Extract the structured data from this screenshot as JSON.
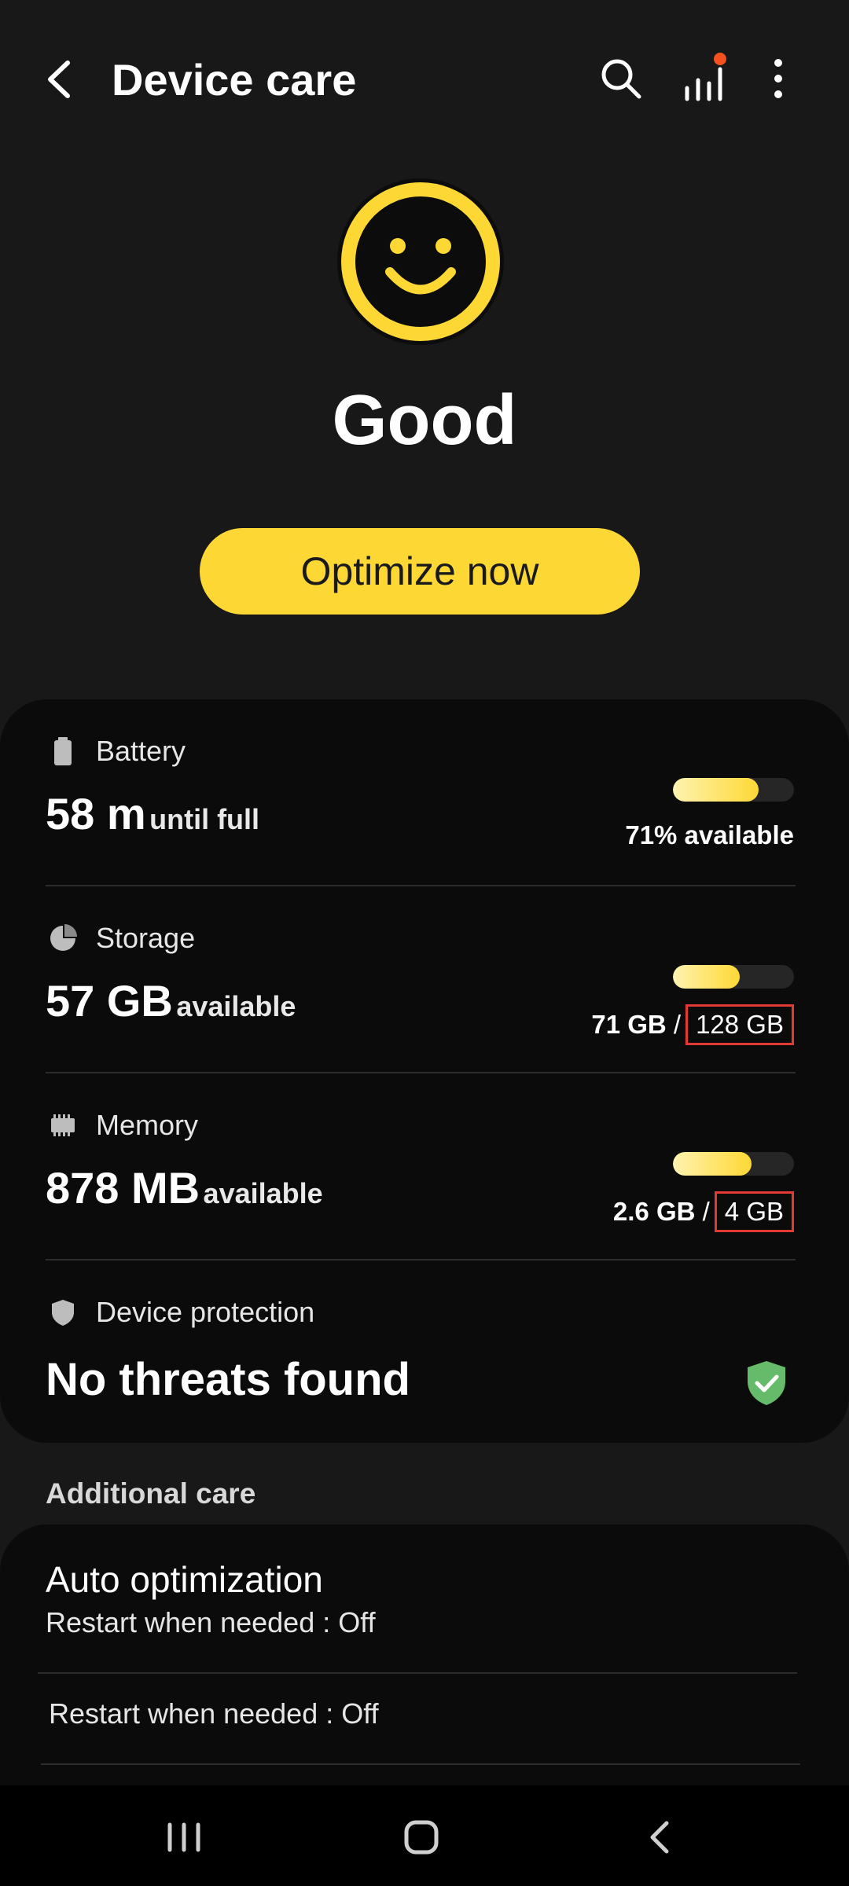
{
  "header": {
    "title": "Device care",
    "icons": [
      "back-arrow-icon",
      "search-icon",
      "signal-bars-icon",
      "more-vert-icon"
    ],
    "notification_dot_color": "#f4511e"
  },
  "status": {
    "icon": "smiley-face-icon",
    "text": "Good",
    "accent_color": "#fdd835"
  },
  "optimize_button": {
    "label": "Optimize now"
  },
  "battery": {
    "label": "Battery",
    "value": "58 m",
    "suffix": "until full",
    "available_text": "71% available",
    "level": 0.71
  },
  "storage": {
    "label": "Storage",
    "value": "57 GB",
    "suffix": "available",
    "used": "71 GB",
    "separator": "/",
    "total": "128 GB",
    "level": 0.55
  },
  "memory": {
    "label": "Memory",
    "value": "878 MB",
    "suffix": "available",
    "used": "2.6 GB",
    "separator": "/",
    "total": "4 GB",
    "level": 0.65
  },
  "protection": {
    "label": "Device protection",
    "status": "No threats found",
    "status_color": "#66bb6a"
  },
  "additional": {
    "section_title": "Additional care",
    "auto_title": "Auto optimization",
    "auto_sub": "Restart when needed : Off",
    "auto_sub2": "Restart when needed : Off"
  },
  "navbar": {
    "icons": [
      "recent-apps-icon",
      "home-icon",
      "back-icon"
    ]
  }
}
